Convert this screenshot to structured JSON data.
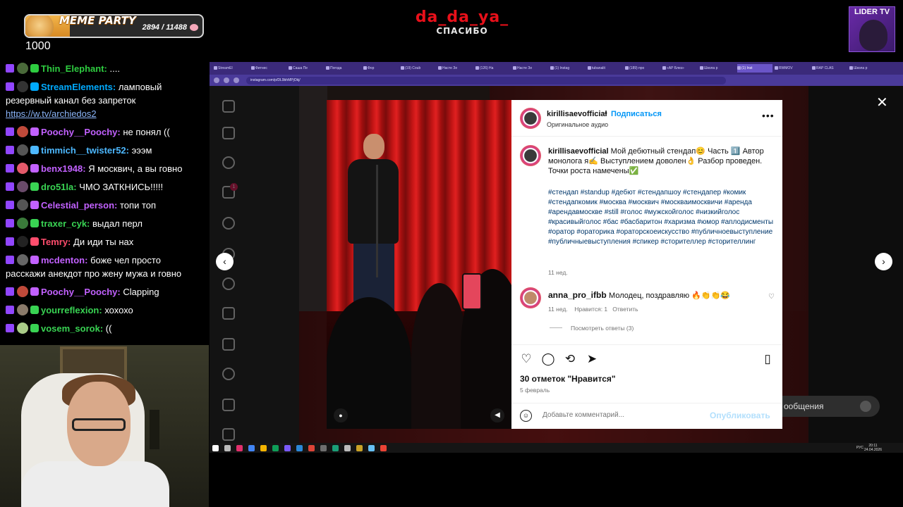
{
  "goal": {
    "title": "MEME PARTY",
    "count": "2894 / 11488",
    "progress": 0.25,
    "sub": "1000"
  },
  "brand": {
    "name": "da_da_ya_",
    "sub": "СПАСИБО"
  },
  "badge": {
    "label": "LIDER TV"
  },
  "chat": [
    {
      "user": "Thin_Elephant:",
      "color": "#2ecc40",
      "text": "....",
      "avatar": "#4a6a3a"
    },
    {
      "user": "StreamElements:",
      "color": "#00aaff",
      "text": "ламповый резервный канал без запреток",
      "link": "https://w.tv/archiedos2",
      "avatar": "#333"
    },
    {
      "user": "Poochy__Poochy:",
      "color": "#c261ff",
      "text": "не понял ((",
      "avatar": "#c04a3a"
    },
    {
      "user": "timmich__twister52:",
      "color": "#4db8ff",
      "text": "эээм",
      "avatar": "#555"
    },
    {
      "user": "benx1948:",
      "color": "#c261ff",
      "text": "Я москвич, а вы говно",
      "avatar": "#e45a6a"
    },
    {
      "user": "dro51la:",
      "color": "#39d353",
      "text": "ЧМО ЗАТКНИСЬ!!!!!",
      "avatar": "#6a4a6a"
    },
    {
      "user": "Celestial_person:",
      "color": "#c261ff",
      "text": "топи топ",
      "avatar": "#555"
    },
    {
      "user": "traxer_cyk:",
      "color": "#39d353",
      "text": "выдал перл",
      "avatar": "#3a7a3a"
    },
    {
      "user": "Temry:",
      "color": "#ff4d6d",
      "text": "Ди иди ты нах",
      "avatar": "#222"
    },
    {
      "user": "mcdenton:",
      "color": "#c261ff",
      "text": "боже чел просто расскажи анекдот про жену мужа и говно",
      "avatar": "#666"
    },
    {
      "user": "Poochy__Poochy:",
      "color": "#c261ff",
      "text": "Clapping",
      "avatar": "#c04a3a"
    },
    {
      "user": "yourreflexion:",
      "color": "#39d353",
      "text": "хохохо",
      "avatar": "#8a7a6a"
    },
    {
      "user": "vosem_sorok:",
      "color": "#39d353",
      "text": "((",
      "avatar": "#aacc88"
    }
  ],
  "browser": {
    "tabs": [
      "StreamEl",
      "Фитнес",
      "Саша Пе",
      "Погода",
      "Фор",
      "(19) Coub",
      "Насте Зе",
      "(126) На",
      "Насте Зе",
      "(1) Instag",
      "tubanalit",
      "(189) про",
      "«АР Блез»",
      "Школа р",
      "(1) Inst",
      "RWMOV",
      "RAP CLAS",
      "Школа р"
    ],
    "url": "instagram.com/p/DL9bhMPjOkj/"
  },
  "post": {
    "username": "kirillisaevofficial",
    "follow": "Подписаться",
    "audio": "Оригинальное аудио",
    "caption": "Мой дебютный стендап😊 Часть 1️⃣ Автор монолога я✍️ Выступлением доволен👌 Разбор проведен. Точки роста намечены✅",
    "hashtags": "#стендап #standup #дебют #стендапшоу #стендапер #комик #стендапкомик #москва #москвич #москваимосквичи #аренда #арендавмоскве #still #голос #мужскойголос #низкийголос #красивыйголос #бас #басбаритон #харизма #юмор #аплодисменты #оратор #ораторика #ораторскоеискусство #публичноевыступление #публичныевыступления #спикер #сторителлер #сторителлинг",
    "ago": "11 нед.",
    "comment_user": "anna_pro_ifbb",
    "comment_text": "Молодец, поздравляю 🔥👏👏😂",
    "comment_ago": "11 нед.",
    "comment_likes": "Нравится: 1",
    "comment_reply": "Ответить",
    "replies": "Посмотреть ответы (3)",
    "likes": "30 отметок \"Нравится\"",
    "date": "5 февраль",
    "placeholder": "Добавьте комментарий...",
    "publish": "Опубликовать"
  },
  "dm": {
    "label": "ообщения"
  },
  "taskbar": {
    "time": "20:11",
    "date": "24.04.2026",
    "lang": "РУС"
  }
}
